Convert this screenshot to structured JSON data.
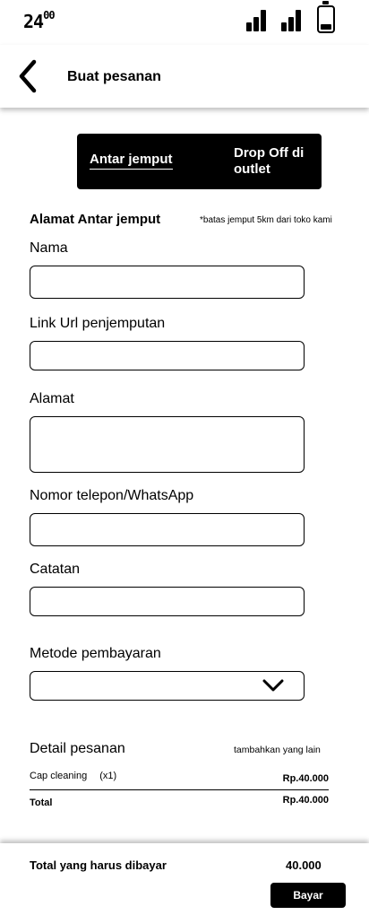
{
  "status": {
    "time_hours": "24",
    "time_minutes": "00",
    "signal_icon": "signal-icon",
    "battery_icon": "battery-icon"
  },
  "header": {
    "back_icon": "back-arrow-icon",
    "title": "Buat pesanan"
  },
  "delivery_tabs": {
    "pickup_label": "Antar jemput",
    "dropoff_label": "Drop Off di outlet",
    "selected": "pickup_label"
  },
  "form": {
    "section_title": "Alamat Antar jemput",
    "limit_note": "*batas jemput 5km dari toko kami",
    "name_label": "Nama",
    "name_value": "",
    "url_label": "Link Url penjemputan",
    "url_value": "",
    "address_label": "Alamat",
    "address_value": "",
    "phone_label": "Nomor telepon/WhatsApp",
    "phone_value": "",
    "notes_label": "Catatan",
    "notes_value": "",
    "payment_label": "Metode pembayaran",
    "payment_value": "",
    "payment_icon": "chevron-down-icon"
  },
  "order": {
    "title": "Detail pesanan",
    "add_more": "tambahkan yang lain",
    "items": [
      {
        "name": "Cap cleaning",
        "qty": "(x1)",
        "price": "Rp.40.000"
      }
    ],
    "total_label": "Total",
    "total_value": "Rp.40.000"
  },
  "footer": {
    "grand_total_label": "Total yang harus dibayar",
    "grand_total_value": "40.000",
    "pay_button": "Bayar"
  }
}
